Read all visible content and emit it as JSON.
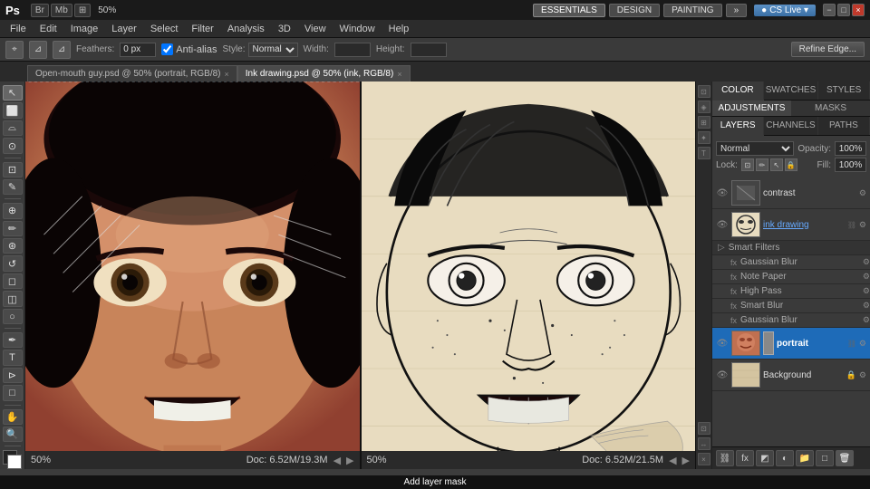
{
  "topBar": {
    "logo": "Ps",
    "menuBtns": [
      "Br",
      "Mb",
      "⊞"
    ],
    "zoom": "50%",
    "navBtns": [
      "ESSENTIALS",
      "DESIGN",
      "PAINTING",
      "»"
    ],
    "csLive": "CS Live ▾",
    "windowBtns": [
      "−",
      "□",
      "×"
    ]
  },
  "menuBar": {
    "items": [
      "File",
      "Edit",
      "Image",
      "Layer",
      "Select",
      "Filter",
      "Analysis",
      "3D",
      "View",
      "Window",
      "Help"
    ]
  },
  "optionsBar": {
    "feathersLabel": "Feathers:",
    "feathersValue": "0 px",
    "antiAlias": "Anti-alias",
    "styleLabel": "Style:",
    "styleValue": "Normal",
    "widthLabel": "Width:",
    "heightLabel": "Height:",
    "refineBtn": "Refine Edge..."
  },
  "tabs": [
    {
      "label": "Open-mouth guy.psd @ 50% (portrait, RGB/8)",
      "active": false
    },
    {
      "label": "Ink drawing.psd @ 50% (ink, RGB/8)",
      "active": false
    }
  ],
  "statusBarLeft": {
    "zoom": "50%",
    "docInfo": "Doc: 6.52M/19.3M"
  },
  "statusBarRight": {
    "zoom": "50%",
    "docInfo": "Doc: 6.52M/21.5M"
  },
  "rightPanel": {
    "topTabs": [
      "COLOR",
      "SWATCHES",
      "STYLES"
    ],
    "subTabs": [
      "ADJUSTMENTS",
      "MASKS"
    ],
    "layerTabs": [
      "LAYERS",
      "CHANNELS",
      "PATHS"
    ],
    "blendMode": "Normal",
    "opacityLabel": "Opacity:",
    "opacityValue": "100%",
    "lockLabel": "Lock:",
    "fillLabel": "Fill:",
    "fillValue": "100%",
    "layers": [
      {
        "name": "contrast",
        "visible": true,
        "active": false,
        "type": "adjustment",
        "hasSettings": true
      },
      {
        "name": "ink drawing",
        "visible": true,
        "active": false,
        "type": "smart",
        "hasSettings": true,
        "hasChain": true
      },
      {
        "name": "portrait",
        "visible": true,
        "active": true,
        "type": "normal",
        "hasSettings": true,
        "hasChain": true
      },
      {
        "name": "Background",
        "visible": true,
        "active": false,
        "type": "normal",
        "hasSettings": true,
        "locked": true
      }
    ],
    "smartFilters": [
      "Gaussian Blur",
      "Note Paper",
      "High Pass",
      "Smart Blur",
      "Gaussian Blur"
    ],
    "bottomBtns": [
      "⊞",
      "fx",
      "◩",
      "◻",
      "📁",
      "🗑"
    ],
    "tooltip": "Add layer mask"
  }
}
